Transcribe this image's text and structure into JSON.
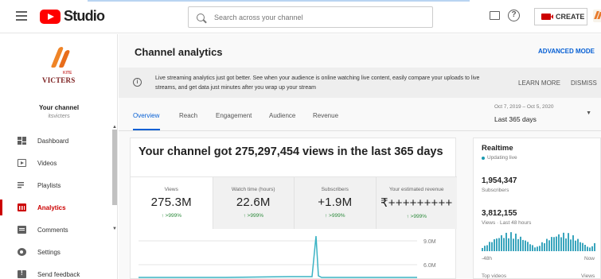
{
  "app": {
    "brand": "Studio",
    "search_placeholder": "Search across your channel",
    "create_label": "CREATE"
  },
  "sidebar": {
    "logo_small_text": "KITE",
    "logo_text": "VICTERS",
    "channel_label": "Your channel",
    "channel_handle": "itsvicters",
    "items": [
      {
        "label": "Dashboard",
        "icon": "dashboard-icon"
      },
      {
        "label": "Videos",
        "icon": "video-icon"
      },
      {
        "label": "Playlists",
        "icon": "playlist-icon"
      },
      {
        "label": "Analytics",
        "icon": "analytics-icon",
        "active": true
      },
      {
        "label": "Comments",
        "icon": "comments-icon"
      },
      {
        "label": "Settings",
        "icon": "gear-icon"
      },
      {
        "label": "Send feedback",
        "icon": "feedback-icon"
      }
    ]
  },
  "main": {
    "title": "Channel analytics",
    "advanced_mode": "ADVANCED MODE",
    "banner": {
      "text": "Live streaming analytics just got better. See when your audience is online watching live content, easily compare your uploads to live streams, and get data just minutes after you wrap up your stream",
      "learn_more": "LEARN MORE",
      "dismiss": "DISMISS"
    },
    "tabs": [
      "Overview",
      "Reach",
      "Engagement",
      "Audience",
      "Revenue"
    ],
    "date_range": {
      "sub": "Oct 7, 2019 – Oct 5, 2020",
      "label": "Last 365 days"
    },
    "headline": "Your channel got 275,297,454 views in the last 365 days",
    "metrics": [
      {
        "label": "Views",
        "value": "275.3M",
        "change": "↑ >999%"
      },
      {
        "label": "Watch time (hours)",
        "value": "22.6M",
        "change": "↑ >999%"
      },
      {
        "label": "Subscribers",
        "value": "+1.9M",
        "change": "↑ >999%"
      },
      {
        "label": "Your estimated revenue",
        "value": "₹+++++++++",
        "change": "↑ >999%"
      }
    ],
    "chart_ticks": [
      "9.0M",
      "6.0M"
    ]
  },
  "realtime": {
    "title": "Realtime",
    "status": "Updating live",
    "subscribers_value": "1,954,347",
    "subscribers_label": "Subscribers",
    "views_value": "3,812,155",
    "views_label": "Views · Last 48 hours",
    "axis_left": "-48h",
    "axis_right": "Now",
    "top_videos": "Top videos",
    "views_col": "Views"
  },
  "colors": {
    "brand_red": "#ff0000",
    "accent_blue": "#065fd4",
    "active_red": "#cc0000",
    "live_teal": "#1a9ab0",
    "positive_green": "#2e8b3d"
  }
}
